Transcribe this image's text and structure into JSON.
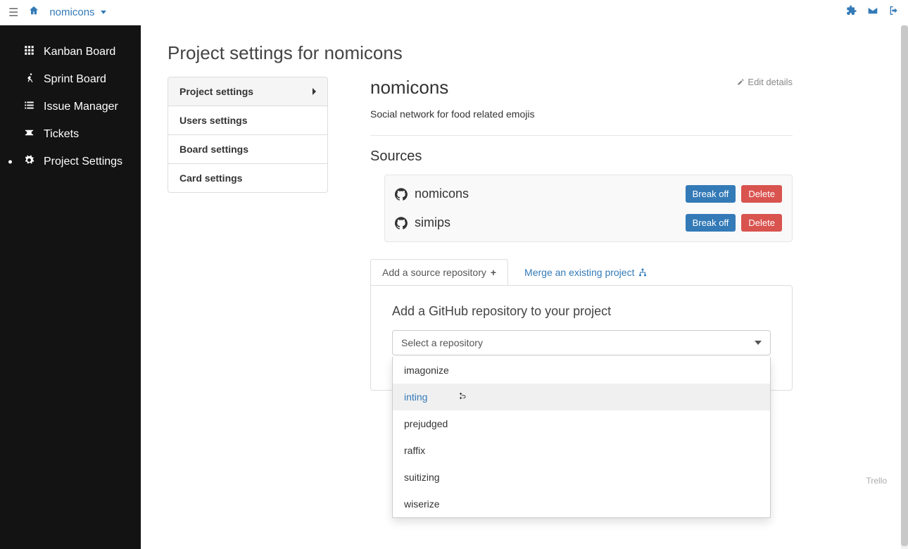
{
  "topbar": {
    "breadcrumb": "nomicons"
  },
  "sidebar": {
    "items": [
      {
        "label": "Kanban Board",
        "icon": "grid"
      },
      {
        "label": "Sprint Board",
        "icon": "runner"
      },
      {
        "label": "Issue Manager",
        "icon": "list"
      },
      {
        "label": "Tickets",
        "icon": "ticket"
      },
      {
        "label": "Project Settings",
        "icon": "gear",
        "active": true
      }
    ]
  },
  "page": {
    "title": "Project settings for nomicons"
  },
  "settings_menu": [
    {
      "label": "Project settings",
      "active": true
    },
    {
      "label": "Users settings"
    },
    {
      "label": "Board settings"
    },
    {
      "label": "Card settings"
    }
  ],
  "project": {
    "name": "nomicons",
    "description": "Social network for food related emojis",
    "edit_label": "Edit details"
  },
  "sources": {
    "heading": "Sources",
    "break_off_label": "Break off",
    "delete_label": "Delete",
    "items": [
      {
        "name": "nomicons"
      },
      {
        "name": "simips"
      }
    ]
  },
  "tabs": {
    "add_source": "Add a source repository",
    "merge_project": "Merge an existing project"
  },
  "add_panel": {
    "heading": "Add a GitHub repository to your project",
    "select_placeholder": "Select a repository",
    "options": [
      {
        "label": "imagonize"
      },
      {
        "label": "inting",
        "highlight": true
      },
      {
        "label": "prejudged"
      },
      {
        "label": "raffix"
      },
      {
        "label": "suitizing"
      },
      {
        "label": "wiserize"
      }
    ]
  },
  "footer": {
    "note": "Trello"
  }
}
